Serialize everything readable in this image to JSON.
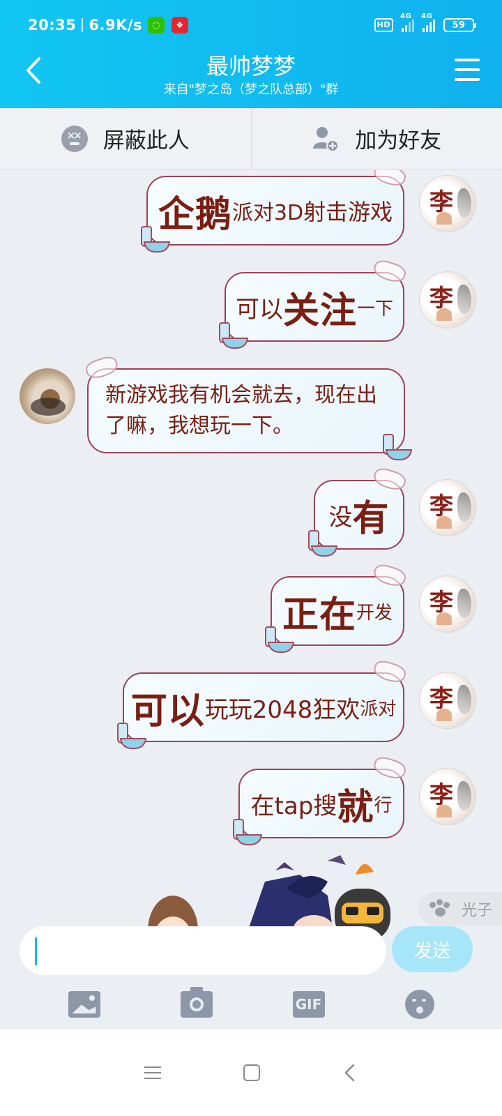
{
  "status_bar": {
    "time": "20:35",
    "speed": "6.9K/s",
    "wechat_icon": "wechat-icon",
    "app_icon": "red-app-icon",
    "hd": "HD",
    "net1": "4G",
    "net2": "4G",
    "battery": "59"
  },
  "header": {
    "title": "最帅梦梦",
    "subtitle": "来自\"梦之岛（梦之队总部）\"群",
    "back_icon": "back-arrow-icon",
    "menu_icon": "menu-icon",
    "bg_color": "#13c6f2"
  },
  "actions": {
    "block_label": "屏蔽此人",
    "add_friend_label": "加为好友"
  },
  "messages": [
    {
      "from": "me",
      "parts": [
        {
          "t": "企鹅",
          "s": "big"
        },
        {
          "t": "派对3D",
          "s": "md"
        },
        {
          "t": "射击游戏",
          "s": "sm2"
        }
      ]
    },
    {
      "from": "me",
      "parts": [
        {
          "t": "可以",
          "s": "md"
        },
        {
          "t": "关注",
          "s": "big"
        },
        {
          "t": "一下",
          "s": "sm"
        }
      ]
    },
    {
      "from": "other",
      "text": "新游戏我有机会就去，现在出了嘛，我想玩一下。"
    },
    {
      "from": "me",
      "parts": [
        {
          "t": "没",
          "s": "md"
        },
        {
          "t": "有",
          "s": "big"
        }
      ]
    },
    {
      "from": "me",
      "parts": [
        {
          "t": "正在",
          "s": "big"
        },
        {
          "t": "开发",
          "s": "sm"
        }
      ]
    },
    {
      "from": "me",
      "parts": [
        {
          "t": "可以",
          "s": "big"
        },
        {
          "t": "玩玩2048狂欢",
          "s": "md"
        },
        {
          "t": "派对",
          "s": "sm"
        }
      ]
    },
    {
      "from": "me",
      "parts": [
        {
          "t": "在tap搜",
          "s": "md"
        },
        {
          "t": "就",
          "s": "big"
        },
        {
          "t": "行",
          "s": "sm"
        }
      ]
    }
  ],
  "peek_chip": {
    "label": "光子"
  },
  "input": {
    "placeholder": "",
    "send_label": "发送"
  },
  "toolbar": {
    "gif_label": "GIF"
  },
  "colors": {
    "bubble_border": "#9c4257",
    "bubble_text": "#7a1e12",
    "send_bg": "#a6e6f8"
  }
}
